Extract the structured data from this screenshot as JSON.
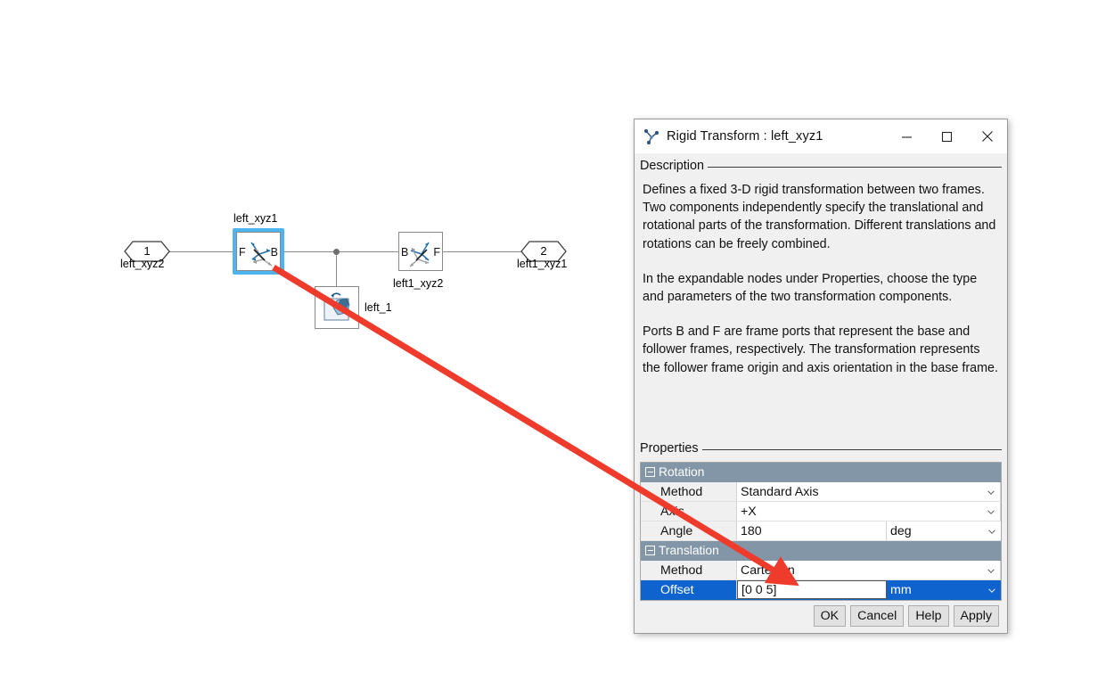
{
  "diagram": {
    "blocks": [
      {
        "id": "in1",
        "type": "inport",
        "number": "1",
        "label": "left_xyz2"
      },
      {
        "id": "tf1",
        "type": "transform",
        "label": "left_xyz1",
        "port_left": "F",
        "port_right": "B",
        "selected": true
      },
      {
        "id": "tf2",
        "type": "transform",
        "label": "left1_xyz2",
        "port_left": "B",
        "port_right": "F",
        "selected": false
      },
      {
        "id": "sol",
        "type": "solid",
        "label": "left_1"
      },
      {
        "id": "out2",
        "type": "outport",
        "number": "2",
        "label": "left1_xyz1"
      }
    ],
    "annotation": {
      "type": "red-arrow",
      "from_label": "left_xyz1 block",
      "to_label": "Offset value field"
    }
  },
  "dialog": {
    "title": "Rigid Transform : left_xyz1",
    "icon": "rigid-transform-icon",
    "window_buttons": {
      "minimize": "minimize-icon",
      "maximize": "maximize-icon",
      "close": "close-icon"
    },
    "description_group": "Description",
    "description_paragraphs": [
      "Defines a fixed 3-D rigid transformation between two frames. Two components independently specify the translational and rotational parts of the transformation. Different translations and rotations can be freely combined.",
      "In the expandable nodes under Properties, choose the type and parameters of the two transformation components.",
      "Ports B and F are frame ports that represent the base and follower frames, respectively. The transformation represents the follower frame origin and axis orientation in the base frame."
    ],
    "properties_group": "Properties",
    "properties": [
      {
        "kind": "section",
        "name": "Rotation",
        "expanded": true
      },
      {
        "kind": "row",
        "name": "Method",
        "value": "Standard Axis",
        "unit": null,
        "has_dropdown": true,
        "selected": false
      },
      {
        "kind": "row",
        "name": "Axis",
        "value": "+X",
        "unit": null,
        "has_dropdown": true,
        "selected": false
      },
      {
        "kind": "row",
        "name": "Angle",
        "value": "180",
        "unit": "deg",
        "has_dropdown": true,
        "selected": false
      },
      {
        "kind": "section",
        "name": "Translation",
        "expanded": true
      },
      {
        "kind": "row",
        "name": "Method",
        "value": "Cartesian",
        "unit": null,
        "has_dropdown": true,
        "selected": false
      },
      {
        "kind": "row",
        "name": "Offset",
        "value": "[0 0 5]",
        "unit": "mm",
        "has_dropdown": true,
        "selected": true
      }
    ],
    "buttons": [
      {
        "id": "ok",
        "label": "OK"
      },
      {
        "id": "cancel",
        "label": "Cancel"
      },
      {
        "id": "help",
        "label": "Help"
      },
      {
        "id": "apply",
        "label": "Apply"
      }
    ]
  },
  "colors": {
    "section_header": "#8396a8",
    "selection_blue": "#0f63ce",
    "annotation_red": "#ef3b2c",
    "block_selection_halo": "#4db4ef",
    "wire_gray": "#8a8a8a",
    "dialog_bg": "#f0f0f0"
  }
}
